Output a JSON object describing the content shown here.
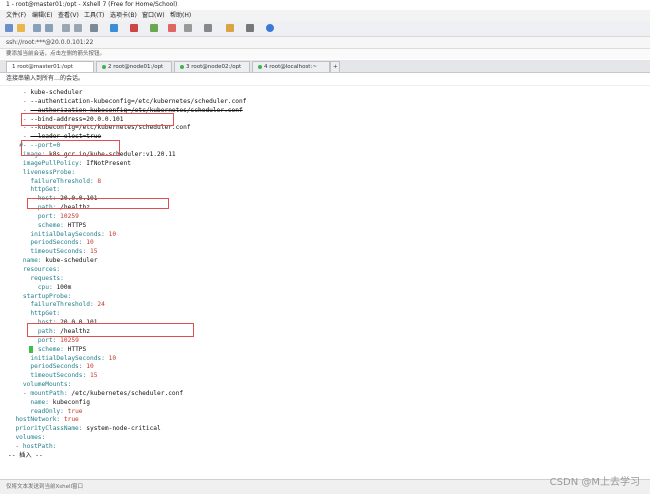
{
  "window": {
    "title": "1 - root@master01:/opt - Xshell 7 (Free for Home/School)"
  },
  "menu": [
    "文件(F)",
    "编辑(E)",
    "查看(V)",
    "工具(T)",
    "选项卡(B)",
    "窗口(W)",
    "帮助(H)"
  ],
  "address": "ssh://root:***@20.0.0.101:22",
  "hint": "要添加当前会话，点击左侧的箭头按钮。",
  "tabs": [
    {
      "label": "1 root@master01:/opt",
      "active": true
    },
    {
      "label": "2 root@node01:/opt",
      "active": false
    },
    {
      "label": "3 root@node02:/opt",
      "active": false
    },
    {
      "label": "4 root@localhost:~",
      "active": false
    }
  ],
  "session_group": "连接串输入到所有…的会话。",
  "terminal": {
    "lines": [
      {
        "i": "    ",
        "d": "- ",
        "k": "",
        "v": "kube-scheduler"
      },
      {
        "i": "    ",
        "d": "- ",
        "k": "",
        "v": "--authentication-kubeconfig=/etc/kubernetes/scheduler.conf"
      },
      {
        "i": "    ",
        "d": "- ",
        "k": "",
        "v": "--authorization-kubeconfig=/etc/kubernetes/scheduler.conf"
      },
      {
        "i": "    ",
        "d": "- ",
        "k": "",
        "v": "--bind-address=20.0.0.101"
      },
      {
        "i": "    ",
        "d": "- ",
        "k": "",
        "v": "--kubeconfig=/etc/kubernetes/scheduler.conf"
      },
      {
        "i": "    ",
        "d": "- ",
        "k": "",
        "v": "--leader-elect=true"
      },
      {
        "i": "   ",
        "d": "",
        "k": "",
        "v": "#- --port=0"
      },
      {
        "i": "    ",
        "d": "",
        "k": "image:",
        "v": " k8s.gcr.io/kube-scheduler:v1.20.11"
      },
      {
        "i": "    ",
        "d": "",
        "k": "imagePullPolicy:",
        "v": " IfNotPresent"
      },
      {
        "i": "    ",
        "d": "",
        "k": "livenessProbe:",
        "v": ""
      },
      {
        "i": "      ",
        "d": "",
        "k": "failureThreshold:",
        "v": " 8"
      },
      {
        "i": "      ",
        "d": "",
        "k": "httpGet:",
        "v": ""
      },
      {
        "i": "        ",
        "d": "",
        "k": "host:",
        "v": " 20.0.0.101"
      },
      {
        "i": "        ",
        "d": "",
        "k": "path:",
        "v": " /healthz"
      },
      {
        "i": "        ",
        "d": "",
        "k": "port:",
        "v": " 10259"
      },
      {
        "i": "        ",
        "d": "",
        "k": "scheme:",
        "v": " HTTPS"
      },
      {
        "i": "      ",
        "d": "",
        "k": "initialDelaySeconds:",
        "v": " 10"
      },
      {
        "i": "      ",
        "d": "",
        "k": "periodSeconds:",
        "v": " 10"
      },
      {
        "i": "      ",
        "d": "",
        "k": "timeoutSeconds:",
        "v": " 15"
      },
      {
        "i": "    ",
        "d": "",
        "k": "name:",
        "v": " kube-scheduler"
      },
      {
        "i": "    ",
        "d": "",
        "k": "resources:",
        "v": ""
      },
      {
        "i": "      ",
        "d": "",
        "k": "requests:",
        "v": ""
      },
      {
        "i": "        ",
        "d": "",
        "k": "cpu:",
        "v": " 100m"
      },
      {
        "i": "    ",
        "d": "",
        "k": "startupProbe:",
        "v": ""
      },
      {
        "i": "      ",
        "d": "",
        "k": "failureThreshold:",
        "v": " 24"
      },
      {
        "i": "      ",
        "d": "",
        "k": "httpGet:",
        "v": ""
      },
      {
        "i": "        ",
        "d": "",
        "k": "host:",
        "v": " 20.0.0.101"
      },
      {
        "i": "        ",
        "d": "",
        "k": "path:",
        "v": " /healthz"
      },
      {
        "i": "        ",
        "d": "",
        "k": "port:",
        "v": " 10259"
      },
      {
        "i": "        ",
        "d": "",
        "k": "scheme:",
        "v": " HTTPS"
      },
      {
        "i": "      ",
        "d": "",
        "k": "initialDelaySeconds:",
        "v": " 10"
      },
      {
        "i": "      ",
        "d": "",
        "k": "periodSeconds:",
        "v": " 10"
      },
      {
        "i": "      ",
        "d": "",
        "k": "timeoutSeconds:",
        "v": " 15"
      },
      {
        "i": "    ",
        "d": "",
        "k": "volumeMounts:",
        "v": ""
      },
      {
        "i": "    ",
        "d": "- ",
        "k": "mountPath:",
        "v": " /etc/kubernetes/scheduler.conf"
      },
      {
        "i": "      ",
        "d": "",
        "k": "name:",
        "v": " kubeconfig"
      },
      {
        "i": "      ",
        "d": "",
        "k": "readOnly:",
        "v": " true"
      },
      {
        "i": "  ",
        "d": "",
        "k": "hostNetwork:",
        "v": " true"
      },
      {
        "i": "  ",
        "d": "",
        "k": "priorityClassName:",
        "v": " system-node-critical"
      },
      {
        "i": "  ",
        "d": "",
        "k": "volumes:",
        "v": ""
      },
      {
        "i": "  ",
        "d": "- ",
        "k": "hostPath:",
        "v": ""
      },
      {
        "i": "",
        "d": "",
        "k": "",
        "v": "-- 插入 --"
      }
    ]
  },
  "status": "仅将文本发送到当前Xshell窗口",
  "watermark": "CSDN @M上去学习",
  "colors": {
    "key": "#1f7e8c",
    "number": "#c0392b",
    "highlight_box": "#e05050",
    "cursor_hl": "#f6d860"
  }
}
